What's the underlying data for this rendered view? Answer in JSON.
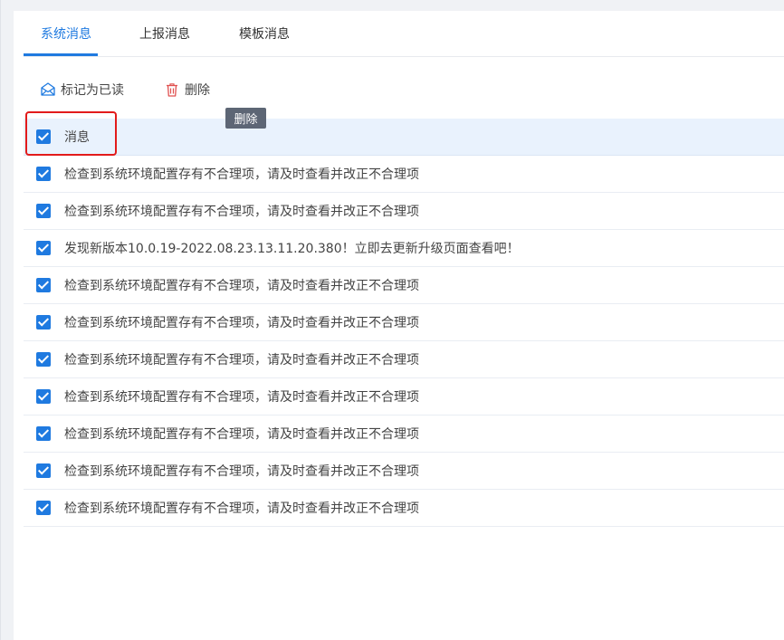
{
  "tabs": [
    {
      "label": "系统消息",
      "active": true
    },
    {
      "label": "上报消息",
      "active": false
    },
    {
      "label": "模板消息",
      "active": false
    }
  ],
  "toolbar": {
    "mark_read_label": "标记为已读",
    "mark_read_icon": "envelope-open-icon",
    "delete_label": "删除",
    "delete_icon": "trash-icon"
  },
  "tooltip": {
    "text": "删除"
  },
  "list": {
    "header": {
      "label": "消息",
      "checked": true
    },
    "items": [
      {
        "text": "检查到系统环境配置存有不合理项，请及时查看并改正不合理项",
        "checked": true
      },
      {
        "text": "检查到系统环境配置存有不合理项，请及时查看并改正不合理项",
        "checked": true
      },
      {
        "text": "发现新版本10.0.19-2022.08.23.13.11.20.380！立即去更新升级页面查看吧！",
        "checked": true
      },
      {
        "text": "检查到系统环境配置存有不合理项，请及时查看并改正不合理项",
        "checked": true
      },
      {
        "text": "检查到系统环境配置存有不合理项，请及时查看并改正不合理项",
        "checked": true
      },
      {
        "text": "检查到系统环境配置存有不合理项，请及时查看并改正不合理项",
        "checked": true
      },
      {
        "text": "检查到系统环境配置存有不合理项，请及时查看并改正不合理项",
        "checked": true
      },
      {
        "text": "检查到系统环境配置存有不合理项，请及时查看并改正不合理项",
        "checked": true
      },
      {
        "text": "检查到系统环境配置存有不合理项，请及时查看并改正不合理项",
        "checked": true
      },
      {
        "text": "检查到系统环境配置存有不合理项，请及时查看并改正不合理项",
        "checked": true
      }
    ]
  },
  "colors": {
    "accent": "#1f7ae0",
    "highlight_border": "#e21b1b",
    "delete_icon": "#e0504f",
    "mark_read_icon": "#1f7ae0",
    "tooltip_bg": "#5d6675"
  }
}
